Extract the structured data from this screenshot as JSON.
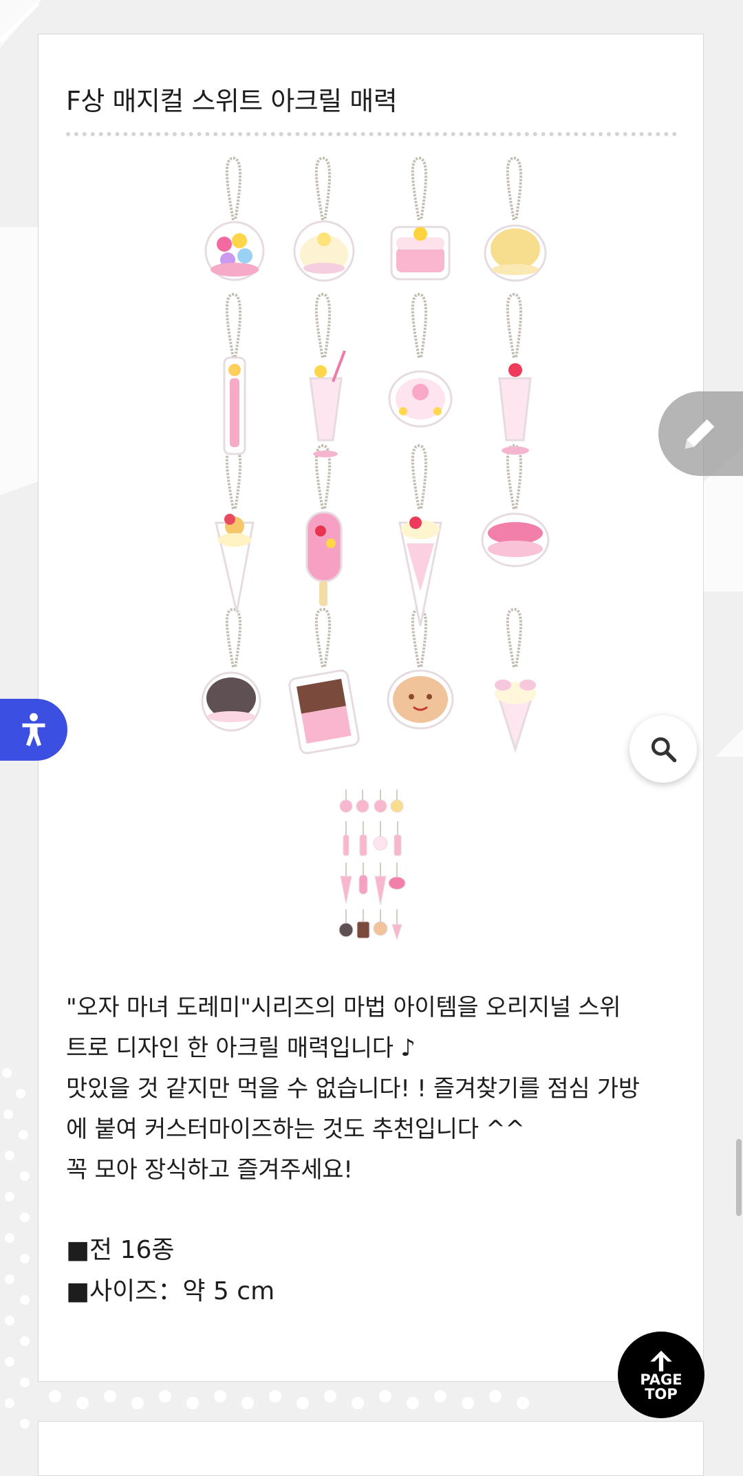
{
  "product": {
    "title": "F상 매지컬 스위트 아크릴 매력",
    "description": [
      "\"오자 마녀 도레미\"시리즈의 마법 아이템을 오리지널 스위",
      "트로 디자인 한 아크릴 매력입니다 ♪",
      "맛있을 것 같지만 먹을 수 없습니다! ! 즐겨찾기를 점심 가방",
      "에 붙여 커스터마이즈하는 것도 추천입니다 ^^",
      "꼭 모아 장식하고 즐겨주세요!"
    ],
    "specs": [
      "■전 16종",
      "■사이즈：약 5 cm"
    ]
  },
  "buttons": {
    "page_top_line1": "PAGE",
    "page_top_line2": "TOP"
  },
  "icons": {
    "zoom": "search-icon",
    "edit": "pencil-icon",
    "accessibility": "accessibility-icon",
    "page_top": "arrow-up-icon"
  },
  "colors": {
    "accessibility_button": "#3b4fe0",
    "page_top_button": "#000000",
    "edit_button": "#969696"
  }
}
